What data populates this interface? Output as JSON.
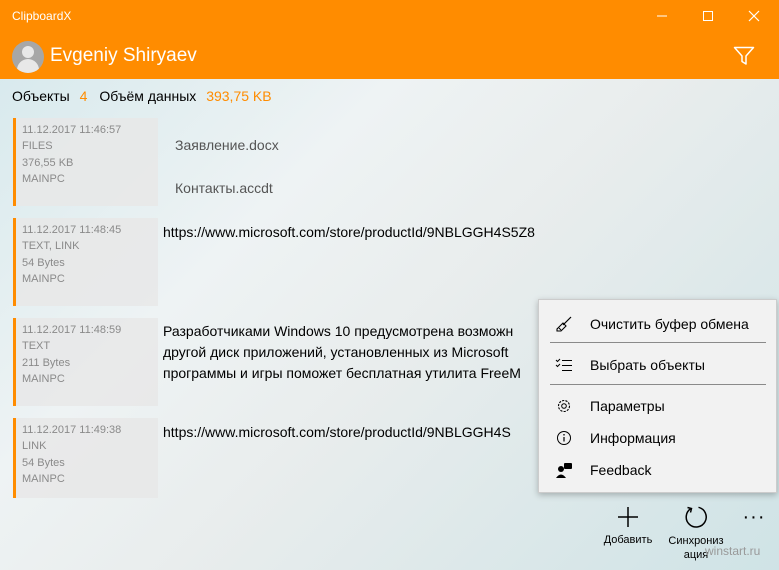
{
  "window": {
    "title": "ClipboardX"
  },
  "header": {
    "user_name": "Evgeniy Shiryaev",
    "filter_icon": "filter-icon",
    "accent_color": "#ff8c00"
  },
  "stats": {
    "objects_label": "Объекты",
    "objects_value": "4",
    "data_label": "Объём данных",
    "data_value": "393,75 KB"
  },
  "items": [
    {
      "date": "11.12.2017 11:46:57",
      "type": "FILES",
      "size": "376,55 KB",
      "device": "MAINPC",
      "files": [
        "Заявление.docx",
        "Контакты.accdt"
      ]
    },
    {
      "date": "11.12.2017 11:48:45",
      "type": "TEXT, LINK",
      "size": "54 Bytes",
      "device": "MAINPC",
      "text": "https://www.microsoft.com/store/productId/9NBLGGH4S5Z8"
    },
    {
      "date": "11.12.2017 11:48:59",
      "type": "TEXT",
      "size": "211 Bytes",
      "device": "MAINPC",
      "lines": [
        "Разработчиками Windows 10 предусмотрена возможн",
        "другой диск приложений, установленных из Microsoft",
        "программы и игры поможет бесплатная утилита FreeM"
      ]
    },
    {
      "date": "11.12.2017 11:49:38",
      "type": "LINK",
      "size": "54 Bytes",
      "device": "MAINPC",
      "text": "https://www.microsoft.com/store/productId/9NBLGGH4S"
    }
  ],
  "menu": {
    "clear": "Очистить буфер обмена",
    "select": "Выбрать объекты",
    "settings": "Параметры",
    "info": "Информация",
    "feedback": "Feedback"
  },
  "commands": {
    "add": "Добавить",
    "sync_line1": "Синхрониз",
    "sync_line2": "ация",
    "more": "···"
  },
  "watermark": "winstart.ru"
}
